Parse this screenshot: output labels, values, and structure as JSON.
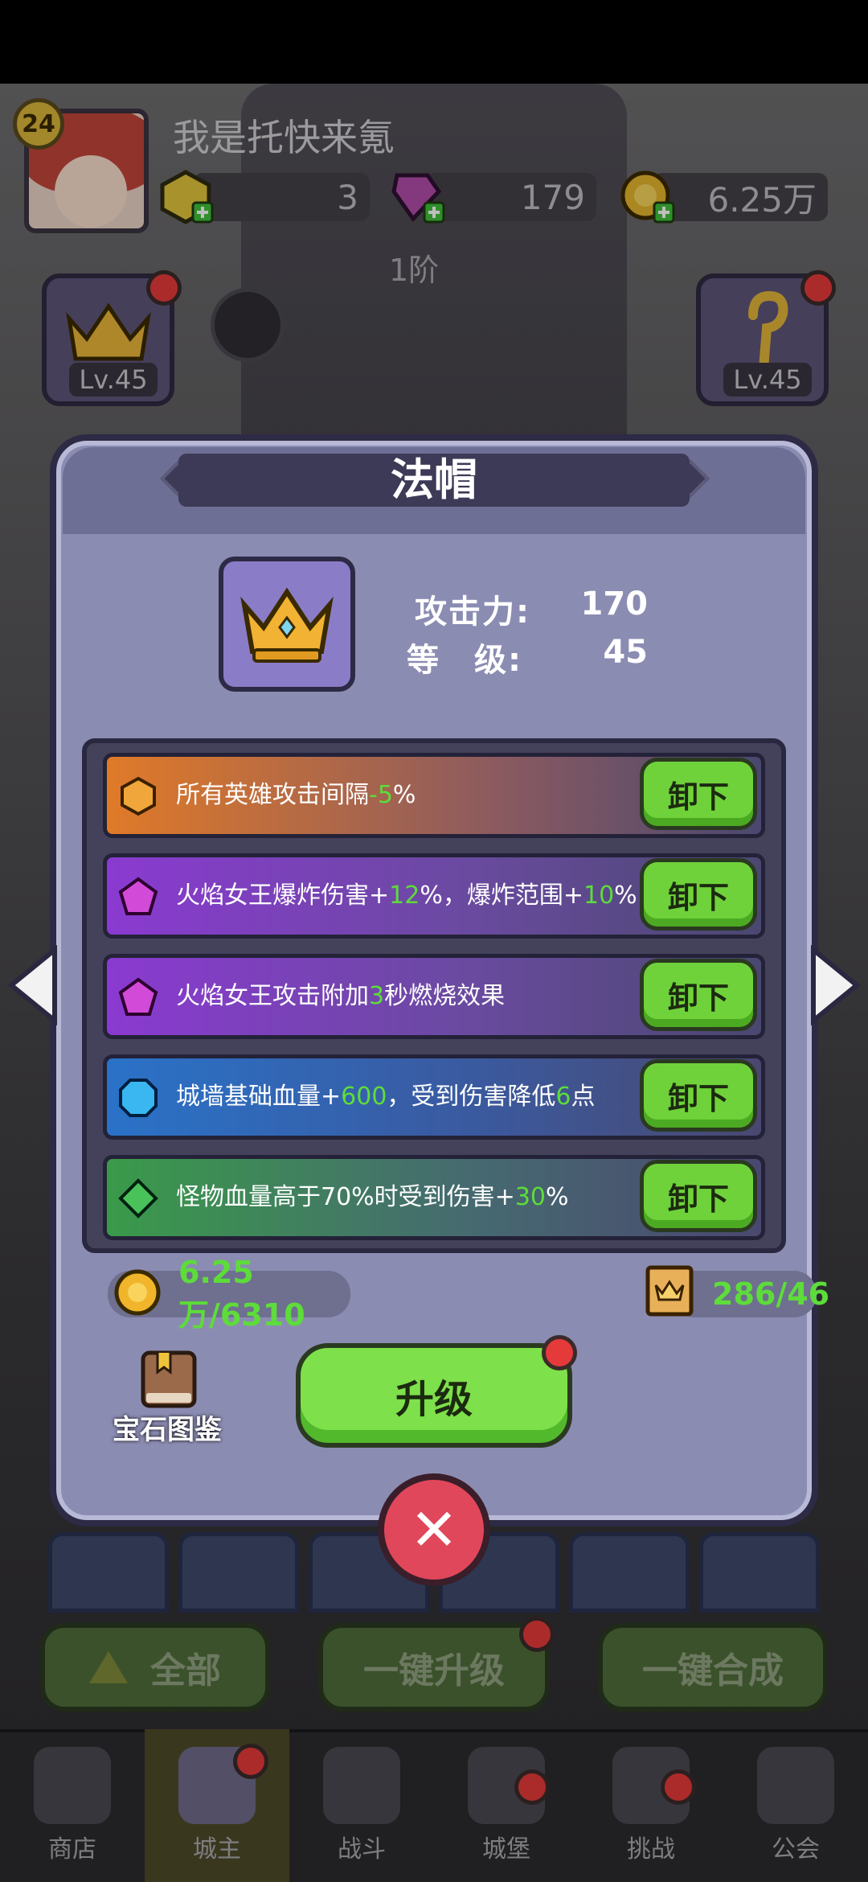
{
  "header": {
    "level": "24",
    "username": "我是托快来氪",
    "resources": [
      "3",
      "179",
      "6.25万"
    ],
    "tier": "1阶"
  },
  "equipment_left": {
    "level": "Lv.45"
  },
  "equipment_right": {
    "level": "Lv.45"
  },
  "dialog": {
    "title": "法帽",
    "stats": {
      "attack_label": "攻击力:",
      "attack_value": "170",
      "level_label": "等　级:",
      "level_value": "45"
    },
    "gems": [
      {
        "pre": "所有英雄攻击间隔",
        "num1": "-5",
        "mid": "%",
        "num2": "",
        "post": "",
        "icon": "amber-hexagon-gem",
        "action": "卸下"
      },
      {
        "pre": "火焰女王爆炸伤害+",
        "num1": "12",
        "mid": "%，爆炸范围+",
        "num2": "10",
        "post": "%",
        "icon": "purple-pentagon-gem",
        "action": "卸下"
      },
      {
        "pre": "火焰女王攻击附加",
        "num1": "3",
        "mid": "秒燃烧效果",
        "num2": "",
        "post": "",
        "icon": "purple-pentagon-gem",
        "action": "卸下"
      },
      {
        "pre": "城墙基础血量+",
        "num1": "600",
        "mid": "，受到伤害降低",
        "num2": "6",
        "post": "点",
        "icon": "blue-octagon-gem",
        "action": "卸下"
      },
      {
        "pre": "怪物血量高于70%时受到伤害+",
        "num1": "30",
        "mid": "%",
        "num2": "",
        "post": "",
        "icon": "green-diamond-gem",
        "action": "卸下"
      }
    ],
    "gold_cost": "6.25万/6310",
    "scroll_cost": "286/46",
    "gem_book_label": "宝石图鉴",
    "upgrade_label": "升级"
  },
  "bottom_actions": [
    "全部",
    "一键升级",
    "一键合成"
  ],
  "nav": [
    {
      "label": "商店",
      "icon": "shop-icon"
    },
    {
      "label": "城主",
      "icon": "lord-icon"
    },
    {
      "label": "战斗",
      "icon": "battle-icon"
    },
    {
      "label": "城堡",
      "icon": "castle-icon"
    },
    {
      "label": "挑战",
      "icon": "challenge-icon"
    },
    {
      "label": "公会",
      "icon": "guild-icon"
    }
  ],
  "colors": {
    "accent_green": "#6fd23a",
    "highlight_green": "#5ddc3a",
    "dialog_bg": "#8b8cb2",
    "badge_red": "#e53a3a"
  }
}
